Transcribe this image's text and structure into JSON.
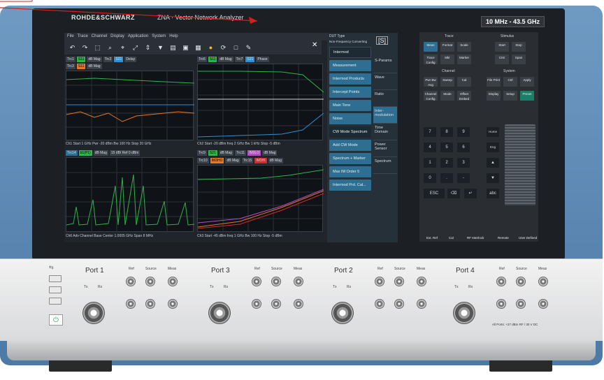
{
  "header": {
    "brand": "ROHDE&SCHWARZ",
    "model": "ZNA · Vector Network Analyzer",
    "freq": "10 MHz - 43.5 GHz"
  },
  "menu": [
    "File",
    "Trace",
    "Channel",
    "Display",
    "Application",
    "System",
    "Help"
  ],
  "toolbar_icons": [
    "undo-icon",
    "redo-icon",
    "zoom-icon",
    "search-icon",
    "marker-icon",
    "expand-icon",
    "autoscale-icon",
    "mark-icon",
    "print-icon",
    "save-icon",
    "screenshot-icon",
    "help-icon",
    "refresh-icon",
    "layout-icon",
    "wrench-icon"
  ],
  "charts": {
    "tl": {
      "tags": [
        "Trc1",
        "S11",
        "dB Mag",
        "Trc2",
        "S21",
        "Delay"
      ],
      "tags2": [
        "Trc3",
        "S11",
        "dB Mag"
      ],
      "status": "Ch1  Start  1 GHz  Pwr  -20 dBm  Bw  100 Hz      Stop  20 GHz"
    },
    "tr": {
      "tags": [
        "Trc6",
        "S11",
        "dB Mag",
        "Trc7",
        "S21",
        "Phase"
      ],
      "status": "Ch2  Start  -20 dBm  freq  2 GHz  Bw  1 kHz      Stop  -5 dBm"
    },
    "bl": {
      "tags": [
        "Trc14",
        "b1(P1)",
        "dB Mag",
        "15 dB/ Ref 0 dBm"
      ],
      "status": "Ch6  Adv Channel Base  Center  1.0005 GHz      Span  8 MHz"
    },
    "br": {
      "tags": [
        "Trc9",
        "S21",
        "dB Mag",
        "Trc11",
        "IM3LO",
        "dB Mag"
      ],
      "tags2": [
        "Trc10",
        "IM3HO",
        "dB Mag",
        "Trc15",
        "IM3HI",
        "dB Mag"
      ],
      "status": "Ch3  Start  -45 dBm  freq  1 GHz  Bw  100 Hz  Stop  -5 dBm"
    }
  },
  "softkeys": {
    "dut_type": "DUT Type",
    "dut_sub": "Non-Frequency Converting",
    "dut_value": "[S]",
    "intermod": "Intermod",
    "buttons": [
      "Measurement",
      "Intermod Products",
      "Intercept Points",
      "Main Tone",
      "Noise",
      "CW Mode Spectrum",
      "Add CW Mode",
      "Spectrum + Marker",
      "Max IM Order 5",
      "Intermod Prd. Cal..."
    ],
    "tabs": [
      "S-Params",
      "Wave",
      "Ratio",
      "Inter-modulation",
      "Time Domain",
      "Power Sensor",
      "Spectrum"
    ]
  },
  "hardkeys": {
    "trace_label": "Trace",
    "stimulus_label": "Stimulus",
    "channel_label": "Channel",
    "system_label": "System",
    "trace": [
      "Meas",
      "Format",
      "Scale",
      "Trace Config",
      "Mkr",
      "Marker"
    ],
    "stimulus": [
      "Start",
      "Stop",
      "Cntr",
      "Span"
    ],
    "channel": [
      "Pwr Bw Avg",
      "Sweep",
      "Cal",
      "Channel Config",
      "Mode",
      "Offset Embed"
    ],
    "system": [
      "File Print",
      "Ctrl",
      "Apply",
      "Display",
      "Setup",
      "Preset"
    ],
    "numpad": [
      "7",
      "8",
      "9",
      "4",
      "5",
      "6",
      "1",
      "2",
      "3",
      "0",
      ".",
      "-",
      "ESC",
      "⌫",
      "↵",
      "abc"
    ],
    "side": [
      "Home",
      "Eng"
    ],
    "footer": [
      "Ext. Ref",
      "Cal",
      "RF Interlock",
      "Remote",
      "User Defined"
    ]
  },
  "ports": [
    {
      "title": "Port 1",
      "tx": "Tx",
      "rx": "Rx",
      "ref": "Ref",
      "source": "Source",
      "meas": "Meas",
      "out": "Out",
      "in": "In"
    },
    {
      "title": "Port 3",
      "tx": "Tx",
      "rx": "Rx",
      "ref": "Ref",
      "source": "Source",
      "meas": "Meas",
      "out": "Out",
      "in": "In"
    },
    {
      "title": "Port 2",
      "tx": "Tx",
      "rx": "Rx",
      "ref": "Ref",
      "source": "Source",
      "meas": "Meas",
      "out": "Out",
      "in": "In"
    },
    {
      "title": "Port 4",
      "tx": "Tx",
      "rx": "Rx",
      "ref": "Ref",
      "source": "Source",
      "meas": "Meas",
      "out": "Out",
      "in": "In"
    }
  ],
  "warning_text": "All Ports: +27 dBm RF / 30 V DC",
  "colors": {
    "accent": "#2f6e93",
    "trace_green": "#2fb44a",
    "trace_orange": "#e37a2a",
    "annotation_red": "#e01b1b"
  }
}
